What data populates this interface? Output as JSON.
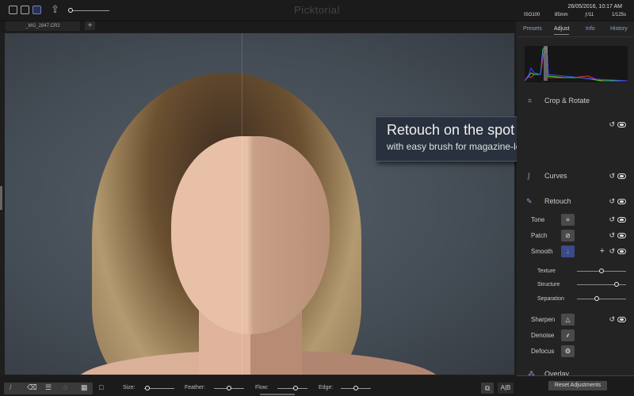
{
  "app": {
    "title": "Picktorial"
  },
  "file_tab": {
    "label": "_MG_2847.CR2"
  },
  "meta": {
    "datetime": "26/05/2016, 10:17 AM",
    "iso": "ISO100",
    "focal": "85mm",
    "aperture": "ƒ/11",
    "shutter": "1/125s"
  },
  "panel_tabs": [
    "Presets",
    "Adjust",
    "Info",
    "History"
  ],
  "callout": {
    "title": "Retouch on the spot",
    "subtitle": "with easy brush for magazine-level results"
  },
  "sections": {
    "crop": "Crop & Rotate",
    "curves": "Curves",
    "retouch": "Retouch",
    "overlay": "Overlay"
  },
  "retouch_tools": [
    {
      "label": "Tone",
      "icon": "sliders-icon"
    },
    {
      "label": "Patch",
      "icon": "bandage-icon"
    },
    {
      "label": "Smooth",
      "icon": "drop-icon"
    }
  ],
  "smooth_sliders": [
    {
      "label": "Texture",
      "value": 0.5
    },
    {
      "label": "Structure",
      "value": 0.8
    },
    {
      "label": "Separation",
      "value": 0.4
    }
  ],
  "detail_tools": [
    {
      "label": "Sharpen",
      "icon": "triangle-icon"
    },
    {
      "label": "Denoise",
      "icon": "broom-icon"
    },
    {
      "label": "Defocus",
      "icon": "aperture-icon"
    }
  ],
  "brush_options": [
    {
      "label": "Size:",
      "value": 0.1
    },
    {
      "label": "Feather:",
      "value": 0.5
    },
    {
      "label": "Flow:",
      "value": 0.6
    },
    {
      "label": "Edge:",
      "value": 0.5
    }
  ],
  "compare": {
    "ab": "A|B"
  },
  "reset_label": "Reset Adjustments",
  "colors": {
    "accent": "#8fa0c8",
    "smooth_active": "#3b4a8a",
    "callout_bg": "#28313d"
  }
}
